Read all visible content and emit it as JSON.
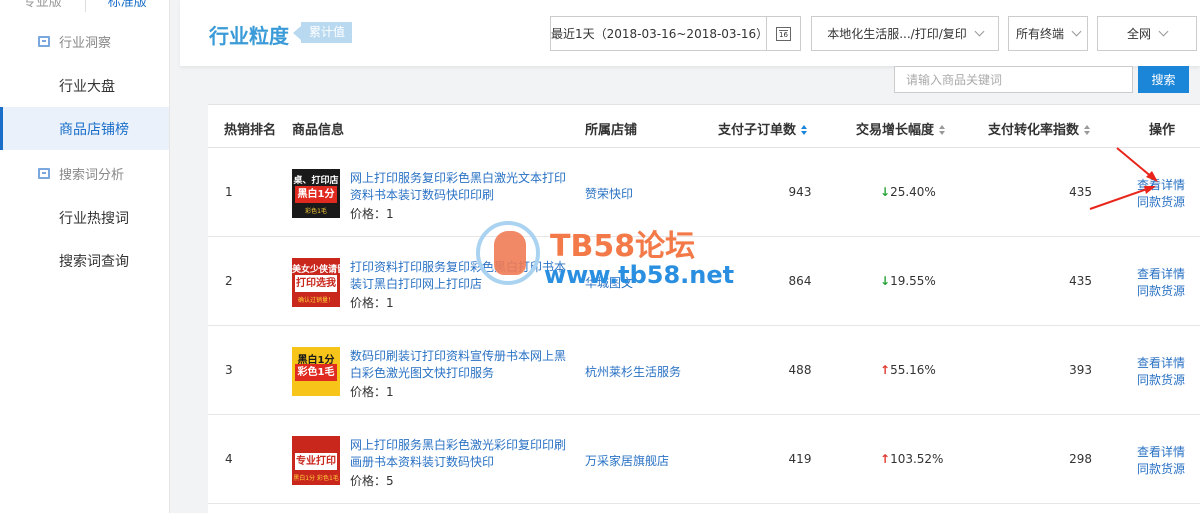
{
  "sidebar": {
    "version_tabs": [
      "专业版",
      "标准版"
    ],
    "sections": [
      {
        "title": "行业洞察",
        "items": [
          "行业大盘",
          "商品店铺榜"
        ]
      },
      {
        "title": "搜索词分析",
        "items": [
          "行业热搜词",
          "搜索词查询"
        ]
      }
    ],
    "active_item": "商品店铺榜"
  },
  "header": {
    "title": "行业粒度",
    "badge": "累计值",
    "date_range": "最近1天（2018-03-16~2018-03-16）",
    "calendar_day": "16",
    "category": "本地化生活服.../打印/复印",
    "terminal": "所有终端",
    "network": "全网"
  },
  "search": {
    "placeholder": "请输入商品关键词",
    "button_label": "搜索"
  },
  "table": {
    "columns": [
      "热销排名",
      "商品信息",
      "所属店铺",
      "支付子订单数",
      "交易增长幅度",
      "支付转化率指数",
      "操作"
    ],
    "price_label": "价格：",
    "op_detail": "查看详情",
    "op_same": "同款货源",
    "rows": [
      {
        "rank": "1",
        "name": "网上打印服务复印彩色黑白激光文本打印资料书本装订数码快印印刷",
        "price": "1",
        "shop": "赞荣快印",
        "orders": "943",
        "growth_dir": "down",
        "growth": "25.40%",
        "conversion": "435",
        "thumb": {
          "t1": "桌、打印店",
          "t2": "黑白1分",
          "t3": "彩色1毛"
        }
      },
      {
        "rank": "2",
        "name": "打印资料打印服务复印彩色黑白打印书本装订黑白打印网上打印店",
        "price": "1",
        "shop": "华城图文",
        "orders": "864",
        "growth_dir": "down",
        "growth": "19.55%",
        "conversion": "435",
        "thumb": {
          "t1": "美女少侠请留步",
          "t2": "打印选我",
          "t3": "确认过销量！"
        }
      },
      {
        "rank": "3",
        "name": "数码印刷装订打印资料宣传册书本网上黑白彩色激光图文快打印服务",
        "price": "1",
        "shop": "杭州莱杉生活服务",
        "orders": "488",
        "growth_dir": "up",
        "growth": "55.16%",
        "conversion": "393",
        "thumb": {
          "t1": "黑白1分",
          "t2": "彩色1毛",
          "t3": ""
        }
      },
      {
        "rank": "4",
        "name": "网上打印服务黑白彩色激光彩印复印印刷画册书本资料装订数码快印",
        "price": "5",
        "shop": "万采家居旗舰店",
        "orders": "419",
        "growth_dir": "up",
        "growth": "103.52%",
        "conversion": "298",
        "thumb": {
          "t1": "",
          "t2": "专业打印",
          "t3": "黑白1分 彩色1毛"
        }
      }
    ]
  },
  "watermark": {
    "title": "TB58论坛",
    "url": "www.tb58.net"
  },
  "colors": {
    "accent": "#1b85d8",
    "link": "#2a72c4",
    "title": "#3a9bd8",
    "up": "#e03a2f",
    "down": "#26a336"
  }
}
